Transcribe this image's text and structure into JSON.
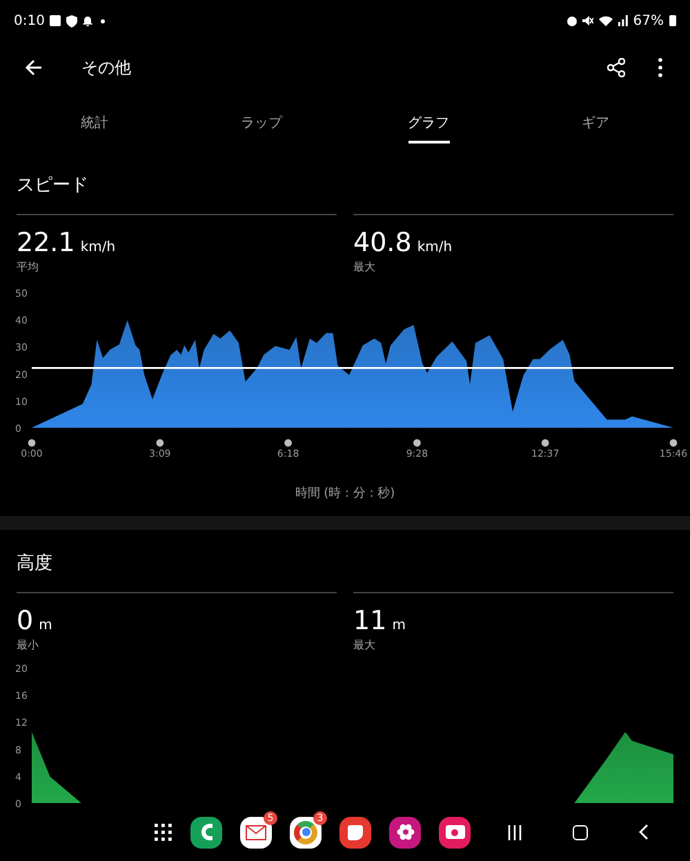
{
  "status_bar": {
    "time": "0:10",
    "battery": "67%"
  },
  "header": {
    "title": "その他"
  },
  "tabs": [
    {
      "label": "統計",
      "selected": false
    },
    {
      "label": "ラップ",
      "selected": false
    },
    {
      "label": "グラフ",
      "selected": true
    },
    {
      "label": "ギア",
      "selected": false
    }
  ],
  "sections": [
    {
      "title": "スピード",
      "stats": [
        {
          "value": "22.1",
          "unit": "km/h",
          "label": "平均"
        },
        {
          "value": "40.8",
          "unit": "km/h",
          "label": "最大"
        }
      ],
      "chart_data": {
        "type": "area",
        "xlabel": "時間 (時 : 分 : 秒)",
        "x": [
          0,
          75,
          88,
          96,
          105,
          115,
          129,
          141,
          153,
          159,
          166,
          178,
          193,
          205,
          214,
          220,
          225,
          231,
          241,
          247,
          254,
          268,
          278,
          292,
          305,
          315,
          332,
          342,
          359,
          380,
          390,
          397,
          410,
          420,
          434,
          444,
          451,
          468,
          488,
          505,
          515,
          522,
          529,
          549,
          563,
          576,
          583,
          597,
          620,
          641,
          646,
          654,
          675,
          695,
          709,
          725,
          739,
          749,
          763,
          783,
          793,
          800,
          848,
          875,
          885,
          946
        ],
        "series": [
          {
            "color": "#2f86e8",
            "values": [
              0,
              8.8,
              16,
              32.5,
              25.8,
              28.8,
              30.8,
              39.8,
              30.5,
              28.8,
              19.5,
              10.5,
              20.3,
              27,
              28.8,
              27,
              30.5,
              27.8,
              32.5,
              22,
              28.8,
              34.7,
              33,
              36,
              31.4,
              17,
              22,
              27,
              30.2,
              28.8,
              33.6,
              22,
              33,
              31.4,
              35,
              35,
              23,
              19.5,
              30.5,
              33,
              31.4,
              23.7,
              30.5,
              36.4,
              38,
              23.7,
              20.3,
              26.3,
              31.9,
              24.6,
              16,
              31.4,
              34.2,
              25.4,
              5.9,
              19.5,
              25.4,
              25.4,
              28.8,
              32.5,
              27,
              17.3,
              3,
              3,
              4.2,
              0
            ]
          }
        ],
        "xlim": [
          0,
          946
        ],
        "ylim": [
          0,
          50
        ],
        "yticks": [
          0,
          10,
          20,
          30,
          40,
          50
        ],
        "xticks": [
          {
            "value": 0,
            "label": "0:00"
          },
          {
            "value": 189,
            "label": "3:09"
          },
          {
            "value": 378,
            "label": "6:18"
          },
          {
            "value": 568,
            "label": "9:28"
          },
          {
            "value": 757,
            "label": "12:37"
          },
          {
            "value": 946,
            "label": "15:46"
          }
        ],
        "ref_lines": [
          {
            "axis": "y",
            "value": 22.1
          }
        ]
      }
    },
    {
      "title": "高度",
      "stats": [
        {
          "value": "0",
          "unit": "m",
          "label": "最小"
        },
        {
          "value": "11",
          "unit": "m",
          "label": "最大"
        }
      ],
      "chart_data": {
        "type": "area",
        "x": [
          0,
          27,
          73,
          120,
          400,
          760,
          800,
          848,
          875,
          885,
          946
        ],
        "series": [
          {
            "color": "#22a84a",
            "values": [
              10.5,
              3.9,
              0,
              0,
              0,
              0,
              0,
              6.6,
              10.5,
              9.2,
              7.2
            ]
          }
        ],
        "xlim": [
          0,
          946
        ],
        "ylim": [
          0,
          20
        ],
        "yticks": [
          0,
          4,
          8,
          12,
          16,
          20
        ]
      }
    }
  ],
  "dock": [
    {
      "kind": "grid"
    },
    {
      "kind": "phone"
    },
    {
      "kind": "mail",
      "badge": "5"
    },
    {
      "kind": "browser",
      "badge": "3"
    },
    {
      "kind": "notes"
    },
    {
      "kind": "flower"
    },
    {
      "kind": "camera"
    }
  ]
}
